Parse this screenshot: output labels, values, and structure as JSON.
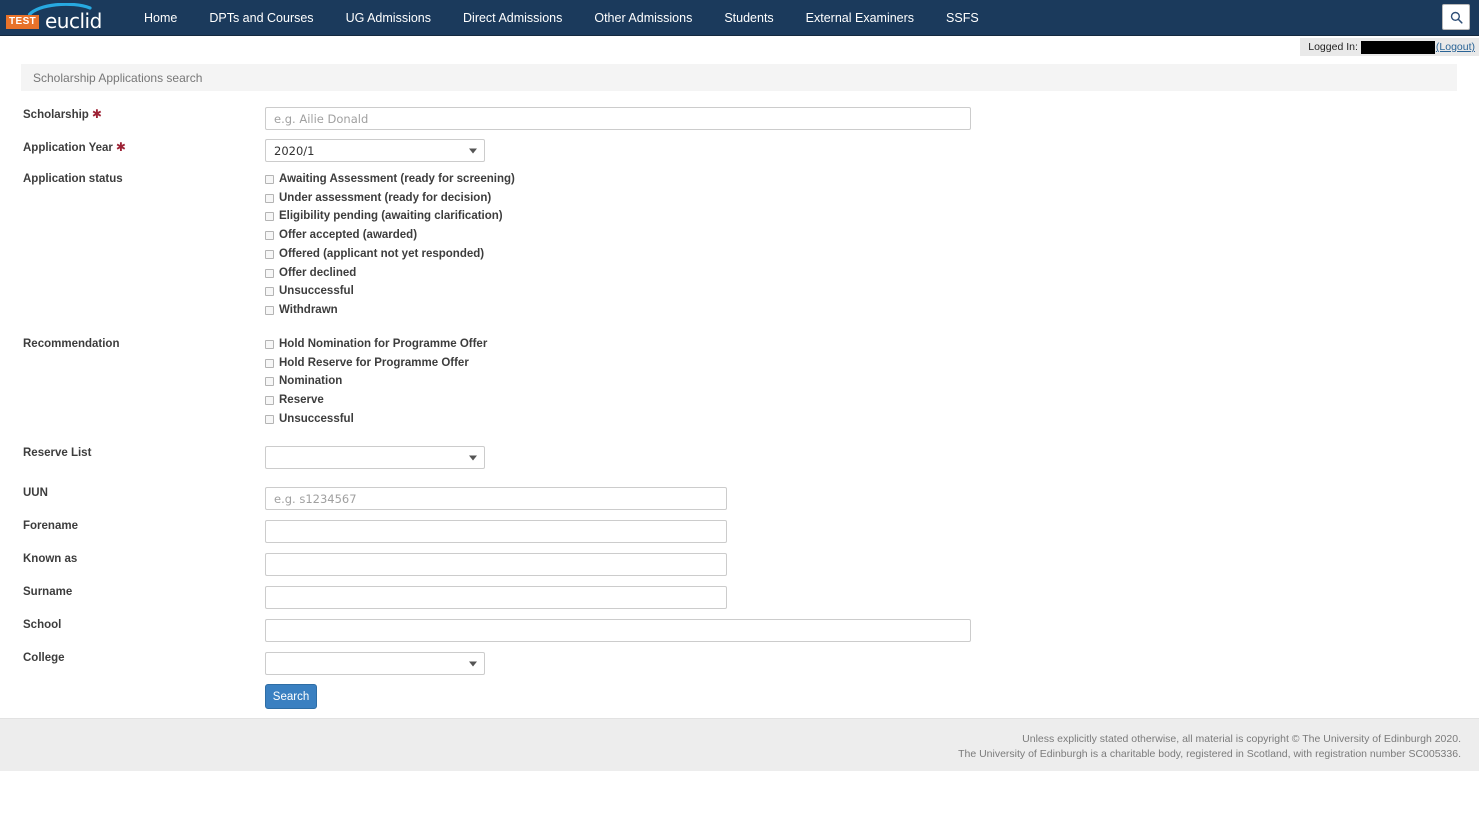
{
  "navbar": {
    "logo": {
      "badge": "TEST",
      "word": "euclid"
    },
    "items": [
      {
        "label": "Home"
      },
      {
        "label": "DPTs and Courses"
      },
      {
        "label": "UG Admissions"
      },
      {
        "label": "Direct Admissions"
      },
      {
        "label": "Other Admissions"
      },
      {
        "label": "Students"
      },
      {
        "label": "External Examiners"
      },
      {
        "label": "SSFS"
      }
    ],
    "search_icon": "search-icon"
  },
  "session": {
    "logged_in_label": "Logged In:",
    "user_redacted": "",
    "logout_label": "(Logout)"
  },
  "page": {
    "title": "Scholarship Applications search"
  },
  "form": {
    "scholarship": {
      "label": "Scholarship",
      "required_marker": "✱",
      "placeholder": "e.g. Ailie Donald",
      "value": ""
    },
    "application_year": {
      "label": "Application Year",
      "required_marker": "✱",
      "value": "2020/1"
    },
    "application_status": {
      "label": "Application status",
      "options": [
        {
          "label": "Awaiting Assessment (ready for screening)",
          "checked": false
        },
        {
          "label": "Under assessment (ready for decision)",
          "checked": false
        },
        {
          "label": "Eligibility pending (awaiting clarification)",
          "checked": false
        },
        {
          "label": "Offer accepted (awarded)",
          "checked": false
        },
        {
          "label": "Offered (applicant not yet responded)",
          "checked": false
        },
        {
          "label": "Offer declined",
          "checked": false
        },
        {
          "label": "Unsuccessful",
          "checked": false
        },
        {
          "label": "Withdrawn",
          "checked": false
        }
      ]
    },
    "recommendation": {
      "label": "Recommendation",
      "options": [
        {
          "label": "Hold Nomination for Programme Offer",
          "checked": false
        },
        {
          "label": "Hold Reserve for Programme Offer",
          "checked": false
        },
        {
          "label": "Nomination",
          "checked": false
        },
        {
          "label": "Reserve",
          "checked": false
        },
        {
          "label": "Unsuccessful",
          "checked": false
        }
      ]
    },
    "reserve_list": {
      "label": "Reserve List",
      "value": ""
    },
    "uun": {
      "label": "UUN",
      "placeholder": "e.g. s1234567",
      "value": ""
    },
    "forename": {
      "label": "Forename",
      "placeholder": "",
      "value": ""
    },
    "known_as": {
      "label": "Known as",
      "placeholder": "",
      "value": ""
    },
    "surname": {
      "label": "Surname",
      "placeholder": "",
      "value": ""
    },
    "school": {
      "label": "School",
      "placeholder": "",
      "value": ""
    },
    "college": {
      "label": "College",
      "value": ""
    },
    "search_button": "Search"
  },
  "footer": {
    "line1": "Unless explicitly stated otherwise, all material is copyright © The University of Edinburgh 2020.",
    "line2": "The University of Edinburgh is a charitable body, registered in Scotland, with registration number SC005336."
  },
  "colors": {
    "navbar": "#1b3a5c",
    "logo_badge": "#e8722a",
    "required": "#9d2235",
    "button": "#3a80c1",
    "footer_bg": "#ededed"
  }
}
